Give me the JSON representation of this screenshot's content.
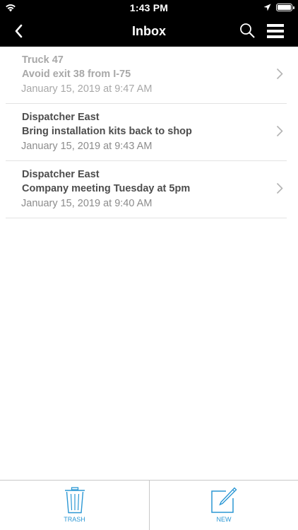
{
  "status_bar": {
    "time": "1:43 PM",
    "icons": [
      "wifi-icon",
      "location-arrow-icon",
      "battery-icon"
    ]
  },
  "nav": {
    "title": "Inbox",
    "icons": [
      "back-chevron-icon",
      "search-icon",
      "hamburger-menu-icon"
    ]
  },
  "messages": [
    {
      "sender": "Truck 47",
      "subject": "Avoid exit 38 from I-75",
      "date": "January 15, 2019 at 9:47 AM",
      "read": true
    },
    {
      "sender": "Dispatcher East",
      "subject": "Bring installation kits back to shop",
      "date": "January 15, 2019 at 9:43 AM",
      "read": false
    },
    {
      "sender": "Dispatcher East",
      "subject": "Company meeting Tuesday at 5pm",
      "date": "January 15, 2019 at 9:40 AM",
      "read": false
    }
  ],
  "tabs": {
    "trash_label": "TRASH",
    "new_label": "NEW"
  },
  "colors": {
    "accent": "#2b97d4",
    "bar_background": "#000000",
    "unread_text": "#4d4d4d",
    "read_text": "#a8a8a8"
  }
}
